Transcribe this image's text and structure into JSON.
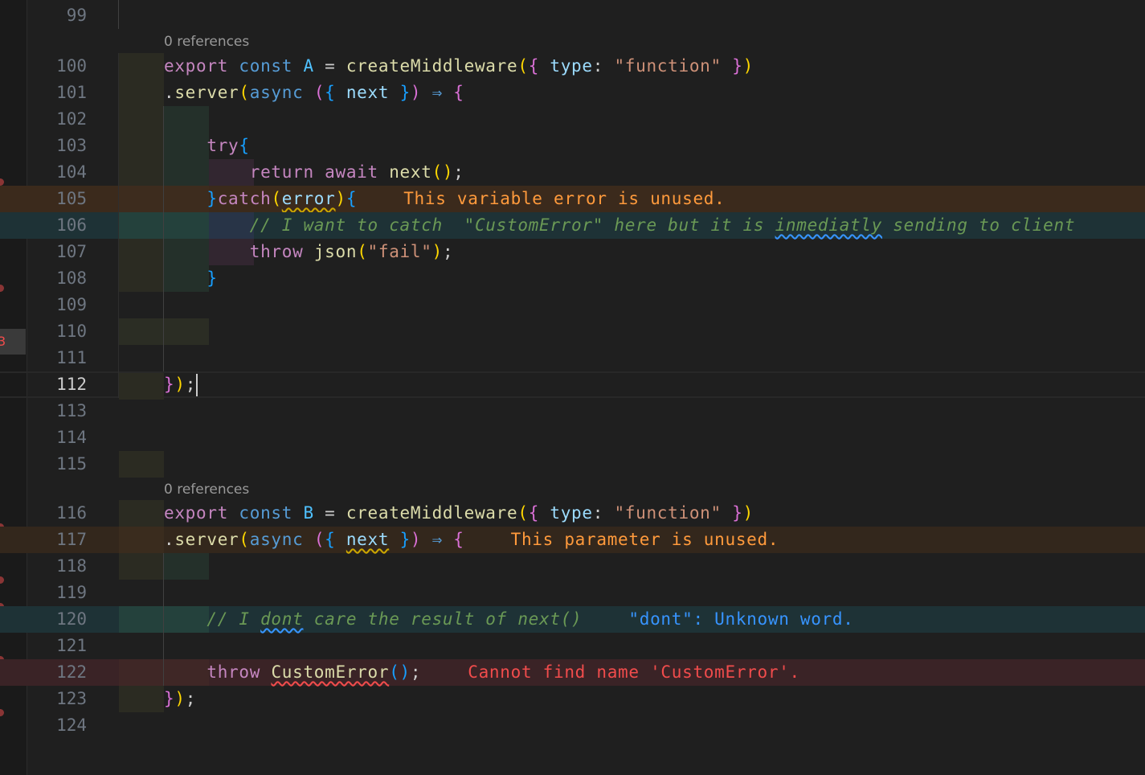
{
  "editor": {
    "strip_badge": "3",
    "codelens": [
      "0 references",
      "0 references"
    ],
    "lines": [
      {
        "n": "99"
      },
      {
        "n": "100",
        "tokens": [
          [
            "export",
            "k"
          ],
          [
            " "
          ],
          [
            "const",
            "kb"
          ],
          [
            " "
          ],
          [
            "A",
            "c"
          ],
          [
            " = "
          ],
          [
            "createMiddleware",
            "f"
          ],
          [
            "(",
            "b1"
          ],
          [
            "{",
            "b2"
          ],
          [
            " "
          ],
          [
            "type",
            "v"
          ],
          [
            ": "
          ],
          [
            "\"function\"",
            "s"
          ],
          [
            " "
          ],
          [
            "}",
            "b2"
          ],
          [
            ")",
            "b1"
          ]
        ]
      },
      {
        "n": "101",
        "tokens": [
          [
            "."
          ],
          [
            "server",
            "f"
          ],
          [
            "(",
            "b1"
          ],
          [
            "async",
            "kb"
          ],
          [
            " "
          ],
          [
            "(",
            "b2"
          ],
          [
            "{",
            "b3"
          ],
          [
            " "
          ],
          [
            "next",
            "v"
          ],
          [
            " "
          ],
          [
            "}",
            "b3"
          ],
          [
            ")",
            "b2"
          ],
          [
            " "
          ],
          [
            "⇒",
            "kb"
          ],
          [
            " "
          ],
          [
            "{",
            "b2"
          ]
        ]
      },
      {
        "n": "102"
      },
      {
        "n": "103",
        "tokens": [
          [
            "    "
          ],
          [
            "try",
            "k"
          ],
          [
            "{",
            "b3"
          ]
        ]
      },
      {
        "n": "104",
        "tokens": [
          [
            "        "
          ],
          [
            "return",
            "k"
          ],
          [
            " "
          ],
          [
            "await",
            "k"
          ],
          [
            " "
          ],
          [
            "next",
            "f"
          ],
          [
            "()",
            "b1"
          ],
          [
            ";"
          ]
        ]
      },
      {
        "n": "105",
        "tokens": [
          [
            "    "
          ],
          [
            "}",
            "b3"
          ],
          [
            "catch",
            "k"
          ],
          [
            "(",
            "b1"
          ],
          [
            "error",
            "v",
            "wavy-y"
          ],
          [
            ")",
            "b1"
          ],
          [
            "{",
            "b3"
          ]
        ],
        "diag": {
          "text": "This variable error is unused.",
          "cls": "diag-w"
        }
      },
      {
        "n": "106",
        "tokens": [
          [
            "        "
          ],
          [
            "// I want to catch  \"CustomError\" here but it is ",
            "cm"
          ],
          [
            "inmediatly",
            "cm",
            "wavy-b"
          ],
          [
            " sending to client",
            "cm"
          ]
        ]
      },
      {
        "n": "107",
        "tokens": [
          [
            "        "
          ],
          [
            "throw",
            "k"
          ],
          [
            " "
          ],
          [
            "json",
            "f"
          ],
          [
            "(",
            "b1"
          ],
          [
            "\"fail\"",
            "s"
          ],
          [
            ")",
            "b1"
          ],
          [
            ";"
          ]
        ]
      },
      {
        "n": "108",
        "tokens": [
          [
            "    "
          ],
          [
            "}",
            "b3"
          ]
        ]
      },
      {
        "n": "109"
      },
      {
        "n": "110"
      },
      {
        "n": "111"
      },
      {
        "n": "112",
        "active": true,
        "cursor": true,
        "tokens": [
          [
            "}",
            "b2"
          ],
          [
            ")",
            "b1"
          ],
          [
            ";"
          ]
        ]
      },
      {
        "n": "113"
      },
      {
        "n": "114"
      },
      {
        "n": "115"
      },
      {
        "n": "116",
        "tokens": [
          [
            "export",
            "k"
          ],
          [
            " "
          ],
          [
            "const",
            "kb"
          ],
          [
            " "
          ],
          [
            "B",
            "c"
          ],
          [
            " = "
          ],
          [
            "createMiddleware",
            "f"
          ],
          [
            "(",
            "b1"
          ],
          [
            "{",
            "b2"
          ],
          [
            " "
          ],
          [
            "type",
            "v"
          ],
          [
            ": "
          ],
          [
            "\"function\"",
            "s"
          ],
          [
            " "
          ],
          [
            "}",
            "b2"
          ],
          [
            ")",
            "b1"
          ]
        ]
      },
      {
        "n": "117",
        "tokens": [
          [
            "."
          ],
          [
            "server",
            "f"
          ],
          [
            "(",
            "b1"
          ],
          [
            "async",
            "kb"
          ],
          [
            " "
          ],
          [
            "(",
            "b2"
          ],
          [
            "{",
            "b3"
          ],
          [
            " "
          ],
          [
            "next",
            "v",
            "wavy-y"
          ],
          [
            " "
          ],
          [
            "}",
            "b3"
          ],
          [
            ")",
            "b2"
          ],
          [
            " "
          ],
          [
            "⇒",
            "kb"
          ],
          [
            " "
          ],
          [
            "{",
            "b2"
          ]
        ],
        "diag": {
          "text": "This parameter is unused.",
          "cls": "diag-w"
        }
      },
      {
        "n": "118"
      },
      {
        "n": "119"
      },
      {
        "n": "120",
        "tokens": [
          [
            "    "
          ],
          [
            "// I ",
            "cm"
          ],
          [
            "dont",
            "cm",
            "wavy-b"
          ],
          [
            " care the result of next()",
            "cm"
          ]
        ],
        "diag": {
          "text": "\"dont\": Unknown word.",
          "cls": "diag-i"
        }
      },
      {
        "n": "121"
      },
      {
        "n": "122",
        "tokens": [
          [
            "    "
          ],
          [
            "throw",
            "k"
          ],
          [
            " "
          ],
          [
            "CustomError",
            "f",
            "wavy-r"
          ],
          [
            "()",
            "b3"
          ],
          [
            ";"
          ]
        ],
        "diag": {
          "text": "Cannot find name 'CustomError'.",
          "cls": "diag-e"
        }
      },
      {
        "n": "123",
        "tokens": [
          [
            "}",
            "b2"
          ],
          [
            ")",
            "b1"
          ],
          [
            ";"
          ]
        ]
      },
      {
        "n": "124"
      }
    ]
  }
}
